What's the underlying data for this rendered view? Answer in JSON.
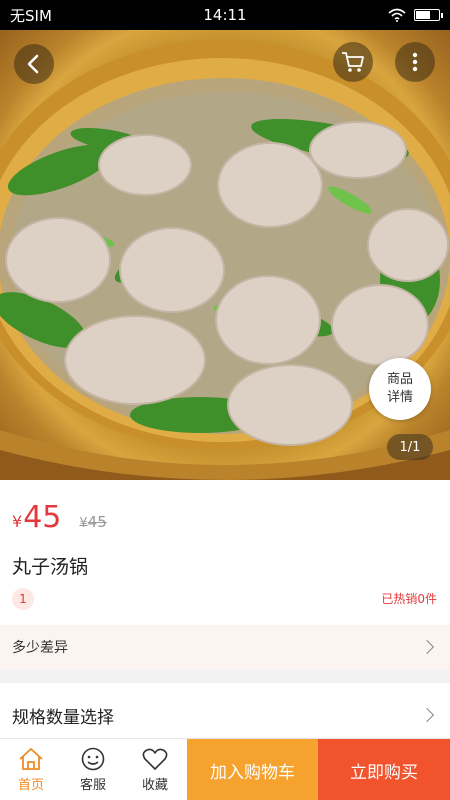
{
  "status_bar": {
    "carrier": "无SIM",
    "time": "14:11",
    "wifi_icon": "wifi-icon",
    "battery_icon": "battery-icon"
  },
  "hero": {
    "image_icon": "meatball-soup-photo",
    "back_icon": "back-arrow-icon",
    "cart_icon": "cart-icon",
    "more_icon": "more-vertical-icon",
    "detail_line1": "商品",
    "detail_line2": "详情",
    "page_indicator": "1/1"
  },
  "product": {
    "currency": "¥",
    "price": "45",
    "old_currency": "¥",
    "old_price": "45",
    "title": "丸子汤锅",
    "quantity_badge": "1",
    "sold_text": "已热销0件"
  },
  "rows": {
    "difference": "多少差异",
    "spec_select": "规格数量选择"
  },
  "bottom_bar": {
    "tabs": [
      {
        "label": "首页",
        "icon": "home-icon",
        "active": true
      },
      {
        "label": "客服",
        "icon": "customer-service-icon",
        "active": false
      },
      {
        "label": "收藏",
        "icon": "heart-icon",
        "active": false
      }
    ],
    "add_to_cart": "加入购物车",
    "buy_now": "立即购买"
  },
  "colors": {
    "accent": "#e4393c",
    "cart_button": "#f5a22e",
    "buy_button": "#f1532c",
    "tab_active": "#f08a24"
  }
}
